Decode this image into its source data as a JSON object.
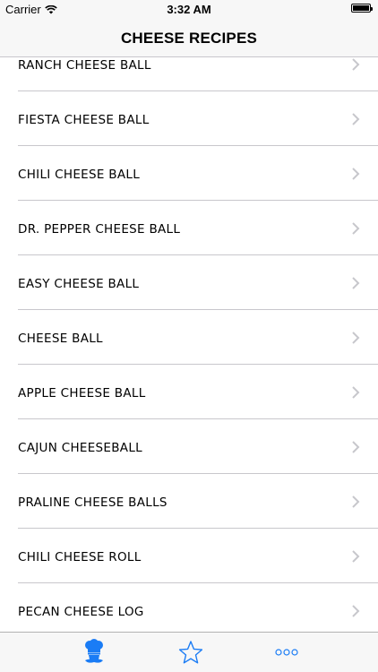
{
  "status_bar": {
    "carrier": "Carrier",
    "time": "3:32 AM",
    "wifi_icon": "wifi-icon",
    "battery_icon": "battery-icon"
  },
  "nav": {
    "title": "CHEESE RECIPES"
  },
  "recipes": [
    {
      "label": "RANCH CHEESE BALL"
    },
    {
      "label": "FIESTA CHEESE BALL"
    },
    {
      "label": "CHILI CHEESE BALL"
    },
    {
      "label": "DR. PEPPER CHEESE BALL"
    },
    {
      "label": "EASY CHEESE BALL"
    },
    {
      "label": "CHEESE BALL"
    },
    {
      "label": "APPLE CHEESE BALL"
    },
    {
      "label": "CAJUN CHEESEBALL"
    },
    {
      "label": "PRALINE CHEESE BALLS"
    },
    {
      "label": "CHILI CHEESE ROLL"
    },
    {
      "label": "PECAN CHEESE LOG"
    }
  ],
  "tab_bar": {
    "tabs": [
      {
        "icon": "chef-icon",
        "selected": true
      },
      {
        "icon": "star-icon",
        "selected": false
      },
      {
        "icon": "more-icon",
        "selected": false
      }
    ],
    "accent_color": "#1a7cf5"
  }
}
